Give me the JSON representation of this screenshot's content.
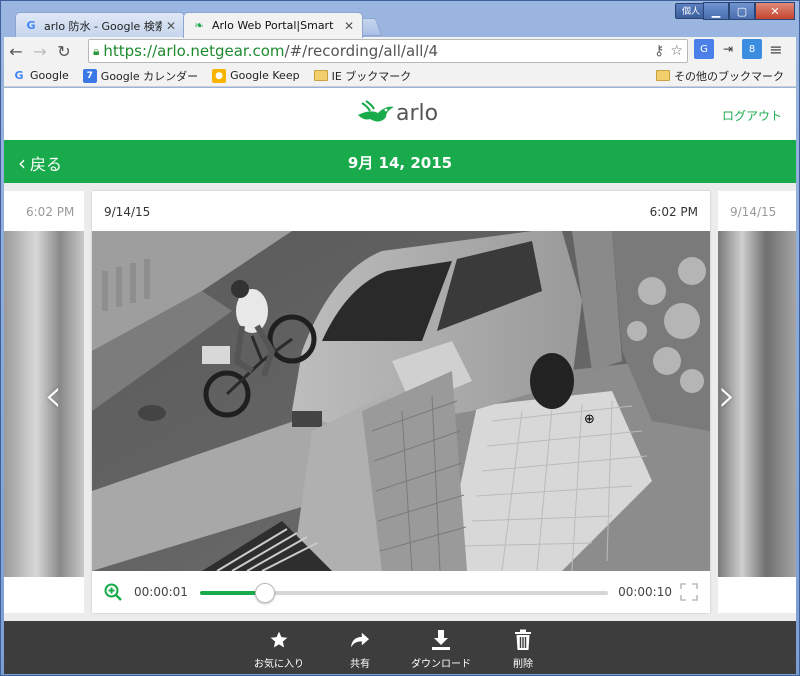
{
  "browser": {
    "tabs": [
      {
        "title": "arlo 防水 - Google 検索",
        "favicon": "google-g-icon"
      },
      {
        "title": "Arlo Web Portal|Smart",
        "favicon": "arlo-icon"
      }
    ],
    "profile_label": "個人",
    "url_secure": "https://arlo.netgear.com",
    "url_rest": "/#/recording/all/all/4",
    "bookmarks": [
      {
        "label": "Google",
        "icon": "google-g-icon"
      },
      {
        "label": "Google カレンダー",
        "icon": "calendar-icon"
      },
      {
        "label": "Google Keep",
        "icon": "keep-icon"
      },
      {
        "label": "IE ブックマーク",
        "icon": "folder-icon"
      }
    ],
    "other_bookmarks": "その他のブックマーク"
  },
  "header": {
    "logo_text": "arlo",
    "logout": "ログアウト"
  },
  "nav": {
    "back": "戻る",
    "title": "9月 14, 2015"
  },
  "prev_card": {
    "time": "6:02 PM"
  },
  "next_card": {
    "date": "9/14/15"
  },
  "card": {
    "date": "9/14/15",
    "time": "6:02 PM"
  },
  "player": {
    "current_time": "00:00:01",
    "total_time": "00:00:10",
    "progress": 0.16
  },
  "actions": [
    {
      "label": "お気に入り",
      "icon": "star-icon"
    },
    {
      "label": "共有",
      "icon": "share-icon"
    },
    {
      "label": "ダウンロード",
      "icon": "download-icon"
    },
    {
      "label": "削除",
      "icon": "trash-icon"
    }
  ],
  "colors": {
    "brand_green": "#19ab4b",
    "action_bar": "#3d3d3d"
  }
}
